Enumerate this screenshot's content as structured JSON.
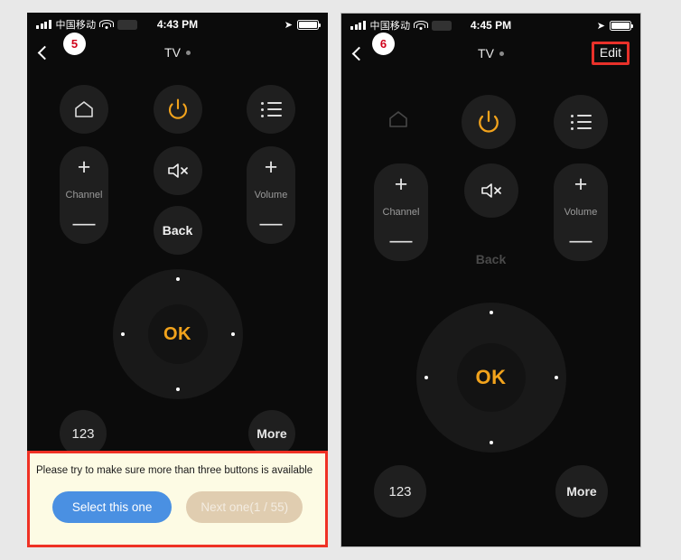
{
  "page": {
    "background_color": "#e8e8e8"
  },
  "colors": {
    "screen_bg": "#0b0b0b",
    "button_bg": "#1f1f1f",
    "accent_orange": "#f2a31c",
    "highlight_red": "#ef3124",
    "primary_blue": "#4a90e2",
    "disabled_tan": "#e0cdb0",
    "panel_cream": "#fdfbe4",
    "badge_red": "#d0021b"
  },
  "left_phone": {
    "badge": "5",
    "statusbar": {
      "carrier": "中国移动",
      "time": "4:43 PM",
      "signal_icon": "signal-bars-icon",
      "wifi_icon": "wifi-icon",
      "battery_chip_icon": "battery-chip-icon",
      "location_icon": "location-arrow-icon",
      "battery_icon": "battery-icon"
    },
    "navbar": {
      "back_icon": "back-chevron-icon",
      "title": "TV",
      "title_dot_icon": "status-dot-icon",
      "edit_label": null
    },
    "remote": {
      "top_row": [
        {
          "name": "home",
          "icon": "home-icon",
          "dimmed": false
        },
        {
          "name": "power",
          "icon": "power-icon",
          "dimmed": false
        },
        {
          "name": "menu",
          "icon": "list-icon",
          "dimmed": false
        }
      ],
      "channel_rocker": {
        "plus": "+",
        "label": "Channel",
        "minus": "—",
        "dimmed": false
      },
      "volume_rocker": {
        "plus": "+",
        "label": "Volume",
        "minus": "—",
        "dimmed": false
      },
      "mute": {
        "icon": "mute-speaker-icon",
        "dimmed": false
      },
      "back": {
        "label": "Back",
        "dimmed": false
      },
      "dpad": {
        "ok_label": "OK",
        "directions": [
          "up",
          "right",
          "down",
          "left"
        ]
      },
      "bottom_row": [
        {
          "name": "numeric",
          "label": "123"
        },
        {
          "name": "more",
          "label": "More"
        }
      ]
    },
    "prompt": {
      "message": "Please try to make sure more than three buttons is available",
      "primary_button": "Select this one",
      "secondary_button": "Next one(1 / 55)"
    }
  },
  "right_phone": {
    "badge": "6",
    "statusbar": {
      "carrier": "中国移动",
      "time": "4:45 PM",
      "signal_icon": "signal-bars-icon",
      "wifi_icon": "wifi-icon",
      "battery_chip_icon": "battery-chip-icon",
      "location_icon": "location-arrow-icon",
      "battery_icon": "battery-icon"
    },
    "navbar": {
      "back_icon": "back-chevron-icon",
      "title": "TV",
      "title_dot_icon": "status-dot-icon",
      "edit_label": "Edit"
    },
    "remote": {
      "top_row": [
        {
          "name": "home",
          "icon": "home-icon",
          "dimmed": true
        },
        {
          "name": "power",
          "icon": "power-icon",
          "dimmed": false
        },
        {
          "name": "menu",
          "icon": "list-icon",
          "dimmed": false
        }
      ],
      "channel_rocker": {
        "plus": "+",
        "label": "Channel",
        "minus": "—",
        "dimmed": false
      },
      "volume_rocker": {
        "plus": "+",
        "label": "Volume",
        "minus": "—",
        "dimmed": false
      },
      "mute": {
        "icon": "mute-speaker-icon",
        "dimmed": false
      },
      "back": {
        "label": "Back",
        "dimmed": true
      },
      "dpad": {
        "ok_label": "OK",
        "directions": [
          "up",
          "right",
          "down",
          "left"
        ]
      },
      "bottom_row": [
        {
          "name": "numeric",
          "label": "123"
        },
        {
          "name": "more",
          "label": "More"
        }
      ]
    }
  }
}
